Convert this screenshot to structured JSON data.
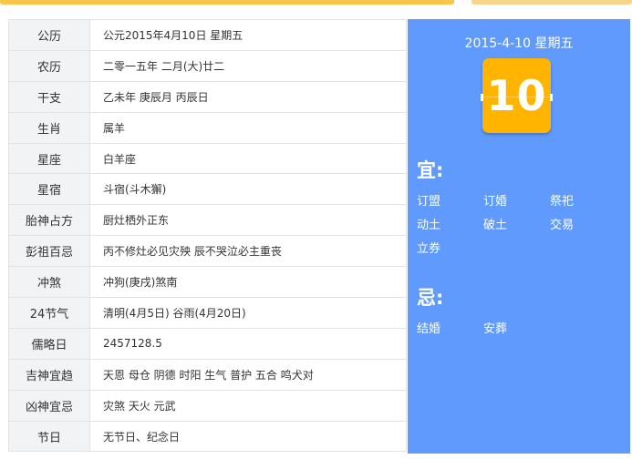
{
  "colors": {
    "panel_bg": "#5f9afc",
    "day_tile": "#ffb400",
    "top_bar_primary": "#f9c548",
    "top_bar_secondary": "#f8d58a",
    "label_bg": "#f2f3f5"
  },
  "table": {
    "rows": [
      {
        "label": "公历",
        "value": "公元2015年4月10日 星期五"
      },
      {
        "label": "农历",
        "value": "二零一五年 二月(大)廿二"
      },
      {
        "label": "干支",
        "value": "乙未年 庚辰月 丙辰日"
      },
      {
        "label": "生肖",
        "value": "属羊"
      },
      {
        "label": "星座",
        "value": "白羊座"
      },
      {
        "label": "星宿",
        "value": "斗宿(斗木獬)"
      },
      {
        "label": "胎神占方",
        "value": "厨灶栖外正东"
      },
      {
        "label": "彭祖百忌",
        "value": "丙不修灶必见灾殃 辰不哭泣必主重丧"
      },
      {
        "label": "冲煞",
        "value": "冲狗(庚戌)煞南"
      },
      {
        "label": "24节气",
        "value": "清明(4月5日) 谷雨(4月20日)"
      },
      {
        "label": "儒略日",
        "value": "2457128.5"
      },
      {
        "label": "吉神宜趋",
        "value": "天恩 母仓 阴德 时阳 生气 普护 五合 鸣犬对"
      },
      {
        "label": "凶神宜忌",
        "value": "灾煞 天火 元武"
      },
      {
        "label": "节日",
        "value": "无节日、纪念日"
      }
    ]
  },
  "panel": {
    "date": "2015-4-10 星期五",
    "day": "10",
    "yi_heading": "宜:",
    "yi_items": [
      "订盟",
      "订婚",
      "祭祀",
      "动土",
      "破土",
      "交易",
      "立券"
    ],
    "ji_heading": "忌:",
    "ji_items": [
      "结婚",
      "安葬"
    ]
  }
}
